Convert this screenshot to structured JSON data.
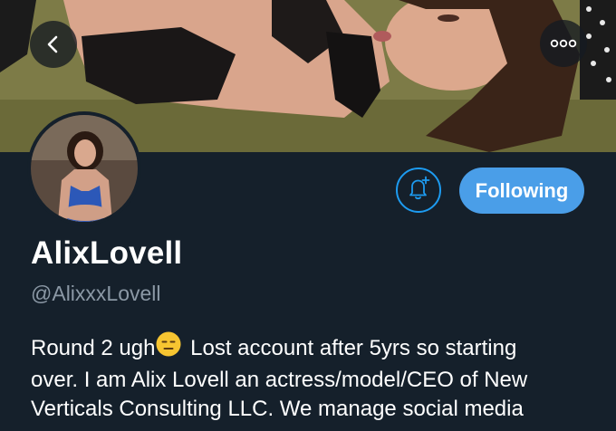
{
  "header": {
    "back_icon": "chevron-left-icon",
    "more_icon": "more-horizontal-icon"
  },
  "profile": {
    "display_name": "AlixLovell",
    "handle": "@AlixxxLovell",
    "follow_button_label": "Following",
    "bell_icon": "notification-bell-plus-icon",
    "accent_color": "#4a9ee8",
    "bio": {
      "line1_before_emoji": "Round 2 ugh",
      "line1_emoji": "expressionless-face-emoji",
      "line1_after_emoji": " Lost account after 5yrs so starting",
      "line2": "over. I am Alix Lovell an actress/model/CEO of New",
      "line3": "Verticals Consulting LLC. We manage social media"
    }
  }
}
